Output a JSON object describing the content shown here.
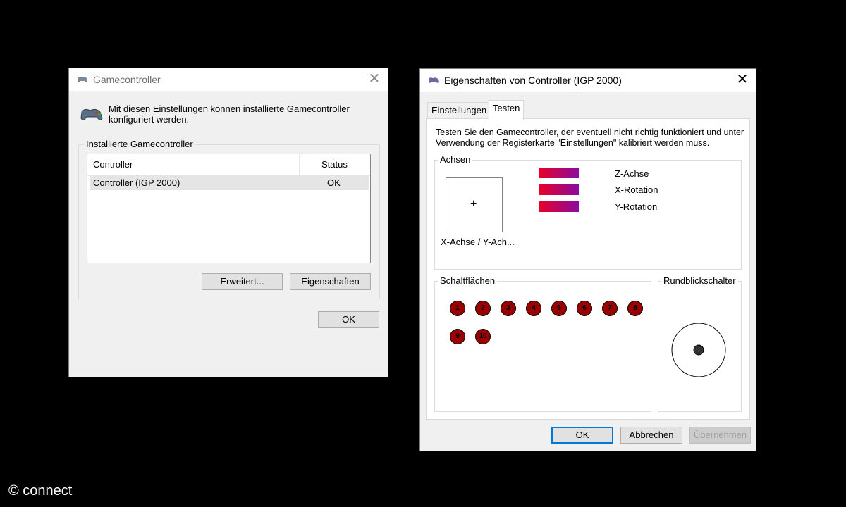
{
  "dialog1": {
    "title": "Gamecontroller",
    "description": "Mit diesen Einstellungen können installierte Gamecontroller konfiguriert werden.",
    "group_label": "Installierte Gamecontroller",
    "columns": [
      "Controller",
      "Status"
    ],
    "rows": [
      {
        "controller": "Controller (IGP 2000)",
        "status": "OK"
      }
    ],
    "buttons": {
      "advanced": "Erweitert...",
      "properties": "Eigenschaften",
      "ok": "OK"
    }
  },
  "dialog2": {
    "title": "Eigenschaften von Controller (IGP 2000)",
    "tabs": [
      "Einstellungen",
      "Testen"
    ],
    "active_tab": "Testen",
    "description": "Testen Sie den Gamecontroller, der eventuell nicht richtig funktioniert und unter Verwendung der Registerkarte \"Einstellungen\" kalibriert werden muss.",
    "axes": {
      "label": "Achsen",
      "xy_label": "X-Achse / Y-Ach...",
      "crosshair": "+",
      "bars": [
        "Z-Achse",
        "X-Rotation",
        "Y-Rotation"
      ]
    },
    "buttons_group": {
      "label": "Schaltflächen",
      "buttons": [
        "1",
        "2",
        "3",
        "4",
        "5",
        "6",
        "7",
        "8",
        "9",
        "10"
      ]
    },
    "pov": {
      "label": "Rundblickschalter"
    },
    "footer": {
      "ok": "OK",
      "cancel": "Abbrechen",
      "apply": "Übernehmen"
    }
  },
  "watermark": "© connect",
  "colors": {
    "axis_bar_start": "#e8002a",
    "axis_bar_end": "#8a0ca0",
    "button_fill": "#9a0000",
    "accent": "#0078d7"
  }
}
